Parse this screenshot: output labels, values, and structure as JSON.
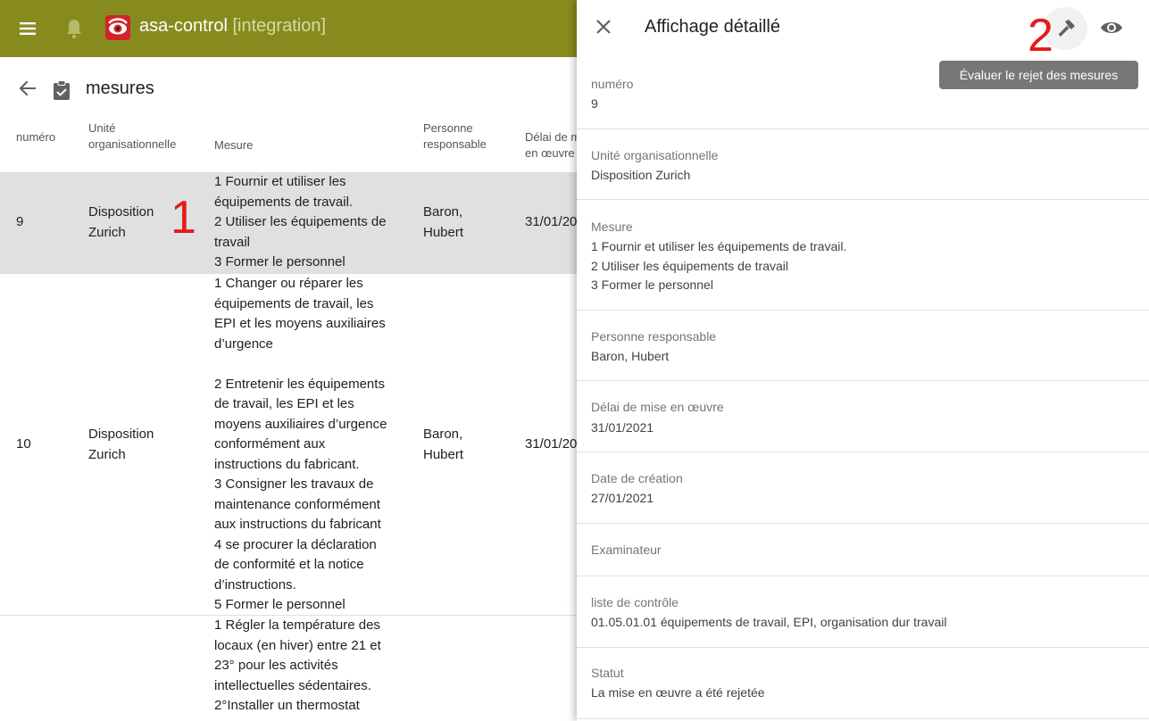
{
  "appbar": {
    "title": "asa-control",
    "environment": "[integration]",
    "background": "#878b1e"
  },
  "page": {
    "title": "mesures"
  },
  "table": {
    "headers": {
      "numero": "numéro",
      "unite": "Unité\norganisationnelle",
      "mesure": "Mesure",
      "personne": "Personne\nresponsable",
      "delai": "Délai de m\nen œuvre"
    },
    "rows": [
      {
        "numero": "9",
        "unite": "Disposition\nZurich",
        "mesure": "1 Fournir et utiliser les\néquipements de travail.\n2 Utiliser les équipements de\ntravail\n3 Former le personnel",
        "personne": "Baron,\nHubert",
        "delai": "31/01/20"
      },
      {
        "numero": "10",
        "unite": "Disposition\nZurich",
        "mesure": "1 Changer ou réparer les\néquipements de travail, les\nEPI et les moyens auxiliaires\nd’urgence\n\n2 Entretenir les équipements\nde travail, les EPI et les\nmoyens auxiliaires d’urgence\nconformément aux\ninstructions du fabricant.\n3 Consigner les travaux de\nmaintenance conformément\naux instructions du fabricant\n4 se procurer la déclaration\nde conformité et la notice\nd’instructions.\n5 Former le personnel",
        "personne": "Baron,\nHubert",
        "delai": "31/01/20"
      },
      {
        "mesure": "1 Régler la température des\nlocaux (en hiver) entre 21 et\n23° pour les activités\nintellectuelles sédentaires.\n2°Installer un thermostat"
      }
    ]
  },
  "annotations": {
    "one": "1",
    "two": "2"
  },
  "panel": {
    "title": "Affichage détaillé",
    "tooltip": "Évaluer le rejet des mesures",
    "fields": [
      {
        "label": "numéro",
        "value": "9"
      },
      {
        "label": "Unité organisationnelle",
        "value": "Disposition Zurich"
      },
      {
        "label": "Mesure",
        "value": "1 Fournir et utiliser les équipements de travail.\n2 Utiliser les équipements de travail\n3 Former le personnel"
      },
      {
        "label": "Personne responsable",
        "value": "Baron, Hubert"
      },
      {
        "label": "Délai de mise en œuvre",
        "value": "31/01/2021"
      },
      {
        "label": "Date de création",
        "value": "27/01/2021"
      },
      {
        "label": "Examinateur",
        "value": ""
      },
      {
        "label": "liste de contrôle",
        "value": "01.05.01.01 équipements de travail, EPI, organisation dur travail"
      },
      {
        "label": "Statut",
        "value": "La mise en œuvre a été rejetée"
      }
    ]
  },
  "icons": {
    "menu": "menu-icon",
    "bell": "bell-icon",
    "logo": "logo-icon",
    "back": "arrow-back-icon",
    "clipboard": "clipboard-check-icon",
    "close": "close-icon",
    "hammer": "hammer-icon",
    "eye": "eye-icon"
  }
}
